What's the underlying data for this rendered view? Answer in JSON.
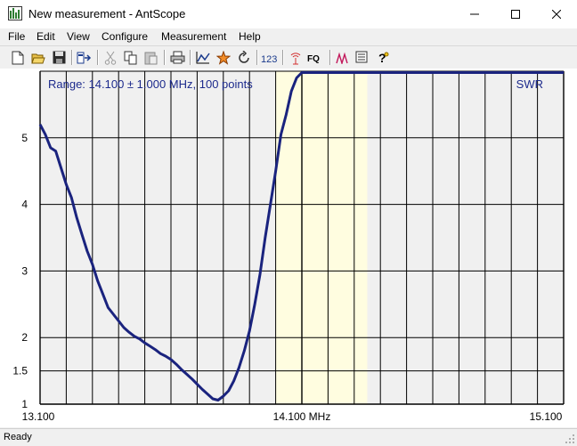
{
  "window": {
    "title": "New measurement - AntScope"
  },
  "menu": [
    "File",
    "Edit",
    "View",
    "Configure",
    "Measurement",
    "Help"
  ],
  "toolbar": {
    "icons": [
      "new-file-icon",
      "open-folder-icon",
      "save-icon",
      "export-icon",
      "cut-icon",
      "copy-icon",
      "paste-icon",
      "print-icon",
      "graph-icon",
      "star-icon",
      "refresh-icon",
      "numeric-view-icon",
      "antenna-icon",
      "frequency-icon",
      "smith-icon",
      "list-icon",
      "help-icon"
    ],
    "numeric_label": "123",
    "fq_label": "FQ"
  },
  "chart_data": {
    "type": "line",
    "title": "Range: 14.100 ± 1.000 MHz, 100 points",
    "ylabel_corner": "SWR",
    "xlim": [
      13.1,
      15.1
    ],
    "ylim": [
      1,
      6
    ],
    "x_tick_labels": [
      "13.100",
      "14.100 MHz",
      "15.100"
    ],
    "y_tick_labels": [
      "1",
      "1.5",
      "2",
      "3",
      "4",
      "5"
    ],
    "y_tick_values": [
      1,
      1.5,
      2,
      3,
      4,
      5
    ],
    "highlight_band": [
      14.0,
      14.35
    ],
    "highlight_band_mid": 14.2,
    "series": [
      {
        "color": "#1a237e",
        "x": [
          13.1,
          13.12,
          13.14,
          13.16,
          13.18,
          13.2,
          13.22,
          13.24,
          13.26,
          13.28,
          13.3,
          13.32,
          13.34,
          13.36,
          13.38,
          13.4,
          13.42,
          13.44,
          13.46,
          13.48,
          13.5,
          13.52,
          13.54,
          13.56,
          13.58,
          13.6,
          13.62,
          13.64,
          13.66,
          13.68,
          13.7,
          13.72,
          13.74,
          13.76,
          13.78,
          13.8,
          13.82,
          13.84,
          13.86,
          13.88,
          13.9,
          13.92,
          13.94,
          13.96,
          13.98,
          14.0,
          14.02,
          14.04,
          14.06,
          14.08,
          14.1,
          14.12,
          14.14,
          14.16,
          14.18,
          14.2,
          14.22,
          14.24,
          14.26,
          14.28,
          14.3,
          14.32,
          14.34,
          14.36,
          14.38,
          14.4,
          14.42,
          14.44,
          14.46,
          14.48,
          14.5,
          14.52,
          14.54,
          14.56,
          14.58,
          14.6,
          14.62,
          14.64,
          14.66,
          14.68,
          14.7,
          14.72,
          14.74,
          14.76,
          14.78,
          14.8,
          14.82,
          14.84,
          14.86,
          14.88,
          14.9,
          14.92,
          14.94,
          14.96,
          14.98,
          15.0,
          15.02,
          15.04,
          15.06,
          15.08,
          15.1
        ],
        "y": [
          5.2,
          5.05,
          4.85,
          4.8,
          4.55,
          4.3,
          4.1,
          3.8,
          3.55,
          3.3,
          3.1,
          2.85,
          2.65,
          2.45,
          2.35,
          2.25,
          2.15,
          2.08,
          2.02,
          1.98,
          1.92,
          1.87,
          1.82,
          1.76,
          1.72,
          1.67,
          1.6,
          1.52,
          1.45,
          1.38,
          1.3,
          1.22,
          1.15,
          1.08,
          1.06,
          1.12,
          1.2,
          1.35,
          1.55,
          1.8,
          2.1,
          2.5,
          2.95,
          3.5,
          4.0,
          4.5,
          5.05,
          5.35,
          5.7,
          5.9,
          5.98,
          5.98,
          5.98,
          5.98,
          5.98,
          5.98,
          5.98,
          5.98,
          5.98,
          5.98,
          5.98,
          5.98,
          5.98,
          5.98,
          5.98,
          5.98,
          5.98,
          5.98,
          5.98,
          5.98,
          5.98,
          5.98,
          5.98,
          5.98,
          5.98,
          5.98,
          5.98,
          5.98,
          5.98,
          5.98,
          5.98,
          5.98,
          5.98,
          5.98,
          5.98,
          5.98,
          5.98,
          5.98,
          5.98,
          5.98,
          5.98,
          5.98,
          5.98,
          5.98,
          5.98,
          5.98,
          5.98,
          5.98,
          5.98,
          5.98,
          5.98
        ]
      }
    ]
  },
  "status": {
    "text": "Ready"
  }
}
